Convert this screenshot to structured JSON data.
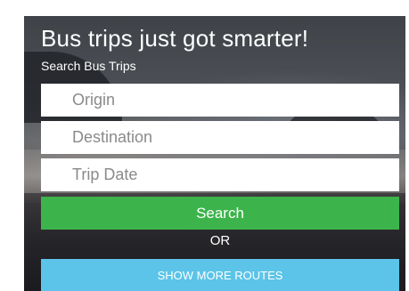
{
  "hero": {
    "title": "Bus trips just got smarter!",
    "subtitle": "Search Bus Trips"
  },
  "form": {
    "origin_placeholder": "Origin",
    "destination_placeholder": "Destination",
    "trip_date_placeholder": "Trip Date",
    "search_label": "Search",
    "or_label": "OR",
    "show_more_label": "SHOW MORE ROUTES"
  },
  "colors": {
    "search_button": "#3cb44b",
    "show_more_button": "#5bc4e8"
  }
}
